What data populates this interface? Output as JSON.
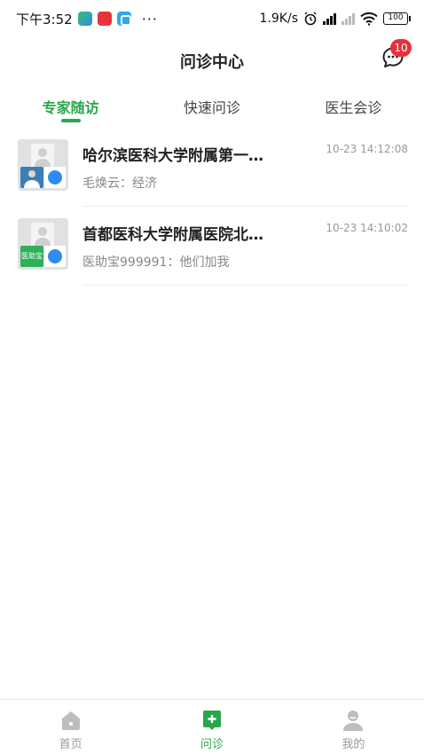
{
  "status_bar": {
    "time": "下午3:52",
    "dots": "···",
    "net_speed": "1.9K/s",
    "battery": "100"
  },
  "header": {
    "title": "问诊中心",
    "message_badge": "10"
  },
  "tabs": [
    {
      "label": "专家随访",
      "active": true
    },
    {
      "label": "快速问诊",
      "active": false
    },
    {
      "label": "医生会诊",
      "active": false
    }
  ],
  "conversations": [
    {
      "title": "哈尔滨医科大学附属第一…",
      "time": "10-23 14:12:08",
      "preview": "毛焕云：经济",
      "avatar_badge": ""
    },
    {
      "title": "首都医科大学附属医院北…",
      "time": "10-23 14:10:02",
      "preview": "医助宝999991：他们加我",
      "avatar_badge": "医助宝"
    }
  ],
  "bottom_nav": [
    {
      "label": "首页",
      "icon": "home-icon",
      "active": false
    },
    {
      "label": "问诊",
      "icon": "consult-icon",
      "active": true
    },
    {
      "label": "我的",
      "icon": "profile-icon",
      "active": false
    }
  ],
  "colors": {
    "accent": "#27a84a",
    "badge": "#e5313a"
  }
}
